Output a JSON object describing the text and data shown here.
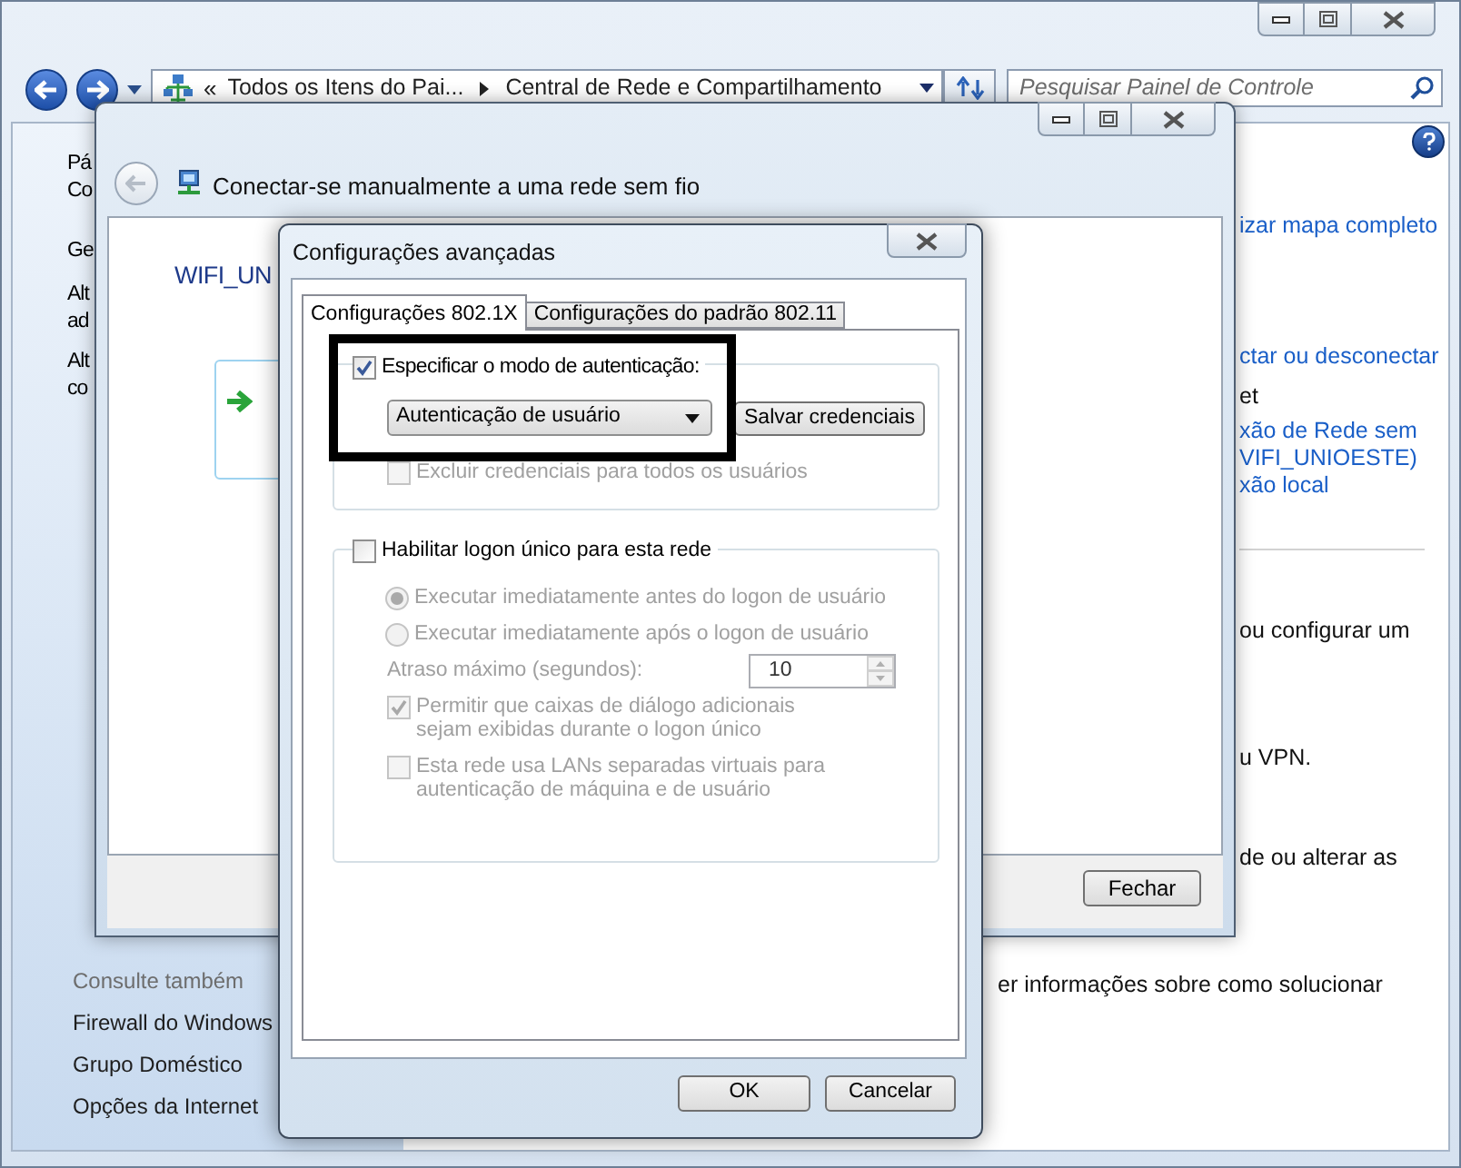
{
  "control_panel": {
    "address_bar": {
      "overflow": "«",
      "crumbs": [
        "Todos os Itens do Pai...",
        "Central de Rede e Compartilhamento"
      ]
    },
    "search": {
      "placeholder": "Pesquisar Painel de Controle"
    },
    "sidebar": {
      "items": [
        "Pá",
        "Co",
        "Ge",
        "Alt",
        "ad",
        "Alt",
        "co"
      ],
      "see_also_title": "Consulte também",
      "see_also": [
        "Firewall do Windows",
        "Grupo Doméstico",
        "Opções da Internet"
      ]
    },
    "main_lines": [
      {
        "text": "izar mapa completo",
        "kind": "link"
      },
      {
        "text": "ctar ou desconectar",
        "kind": "link"
      },
      {
        "text": "et",
        "kind": "text"
      },
      {
        "text": "xão de Rede sem",
        "kind": "link"
      },
      {
        "text": "VIFI_UNIOESTE)",
        "kind": "link"
      },
      {
        "text": "xão local",
        "kind": "link"
      },
      {
        "text": "ou configurar um",
        "kind": "text"
      },
      {
        "text": "u VPN.",
        "kind": "text"
      },
      {
        "text": "de ou alterar as",
        "kind": "text"
      }
    ],
    "bottom_line": "er informações sobre como solucionar"
  },
  "connect_window": {
    "title": "Conectar-se manualmente a uma rede sem fio",
    "network_name": "WIFI_UN",
    "close_button": "Fechar"
  },
  "advanced_dialog": {
    "title": "Configurações avançadas",
    "tabs": [
      {
        "label": "Configurações 802.1X",
        "selected": true
      },
      {
        "label": "Configurações do padrão 802.11",
        "selected": false
      }
    ],
    "auth": {
      "label": "Especificar o modo de autenticação:",
      "checked": true,
      "mode": "Autenticação de usuário",
      "save_button": "Salvar credenciais",
      "exclude": {
        "label": "Excluir credenciais para todos os usuários",
        "checked": false,
        "disabled": true
      }
    },
    "sso": {
      "label": "Habilitar logon único para esta rede",
      "checked": false,
      "timing": [
        {
          "label": "Executar imediatamente antes do logon de usuário",
          "selected": true,
          "disabled": true
        },
        {
          "label": "Executar imediatamente após o logon de usuário",
          "selected": false,
          "disabled": true
        }
      ],
      "delay_label": "Atraso máximo (segundos):",
      "delay_value": "10",
      "options": [
        {
          "label": "Permitir que caixas de diálogo adicionais sejam exibidas durante o logon único",
          "checked": true,
          "disabled": true
        },
        {
          "label": "Esta rede usa LANs separadas virtuais para autenticação de máquina e de usuário",
          "checked": false,
          "disabled": true
        }
      ]
    },
    "buttons": [
      "OK",
      "Cancelar"
    ]
  }
}
